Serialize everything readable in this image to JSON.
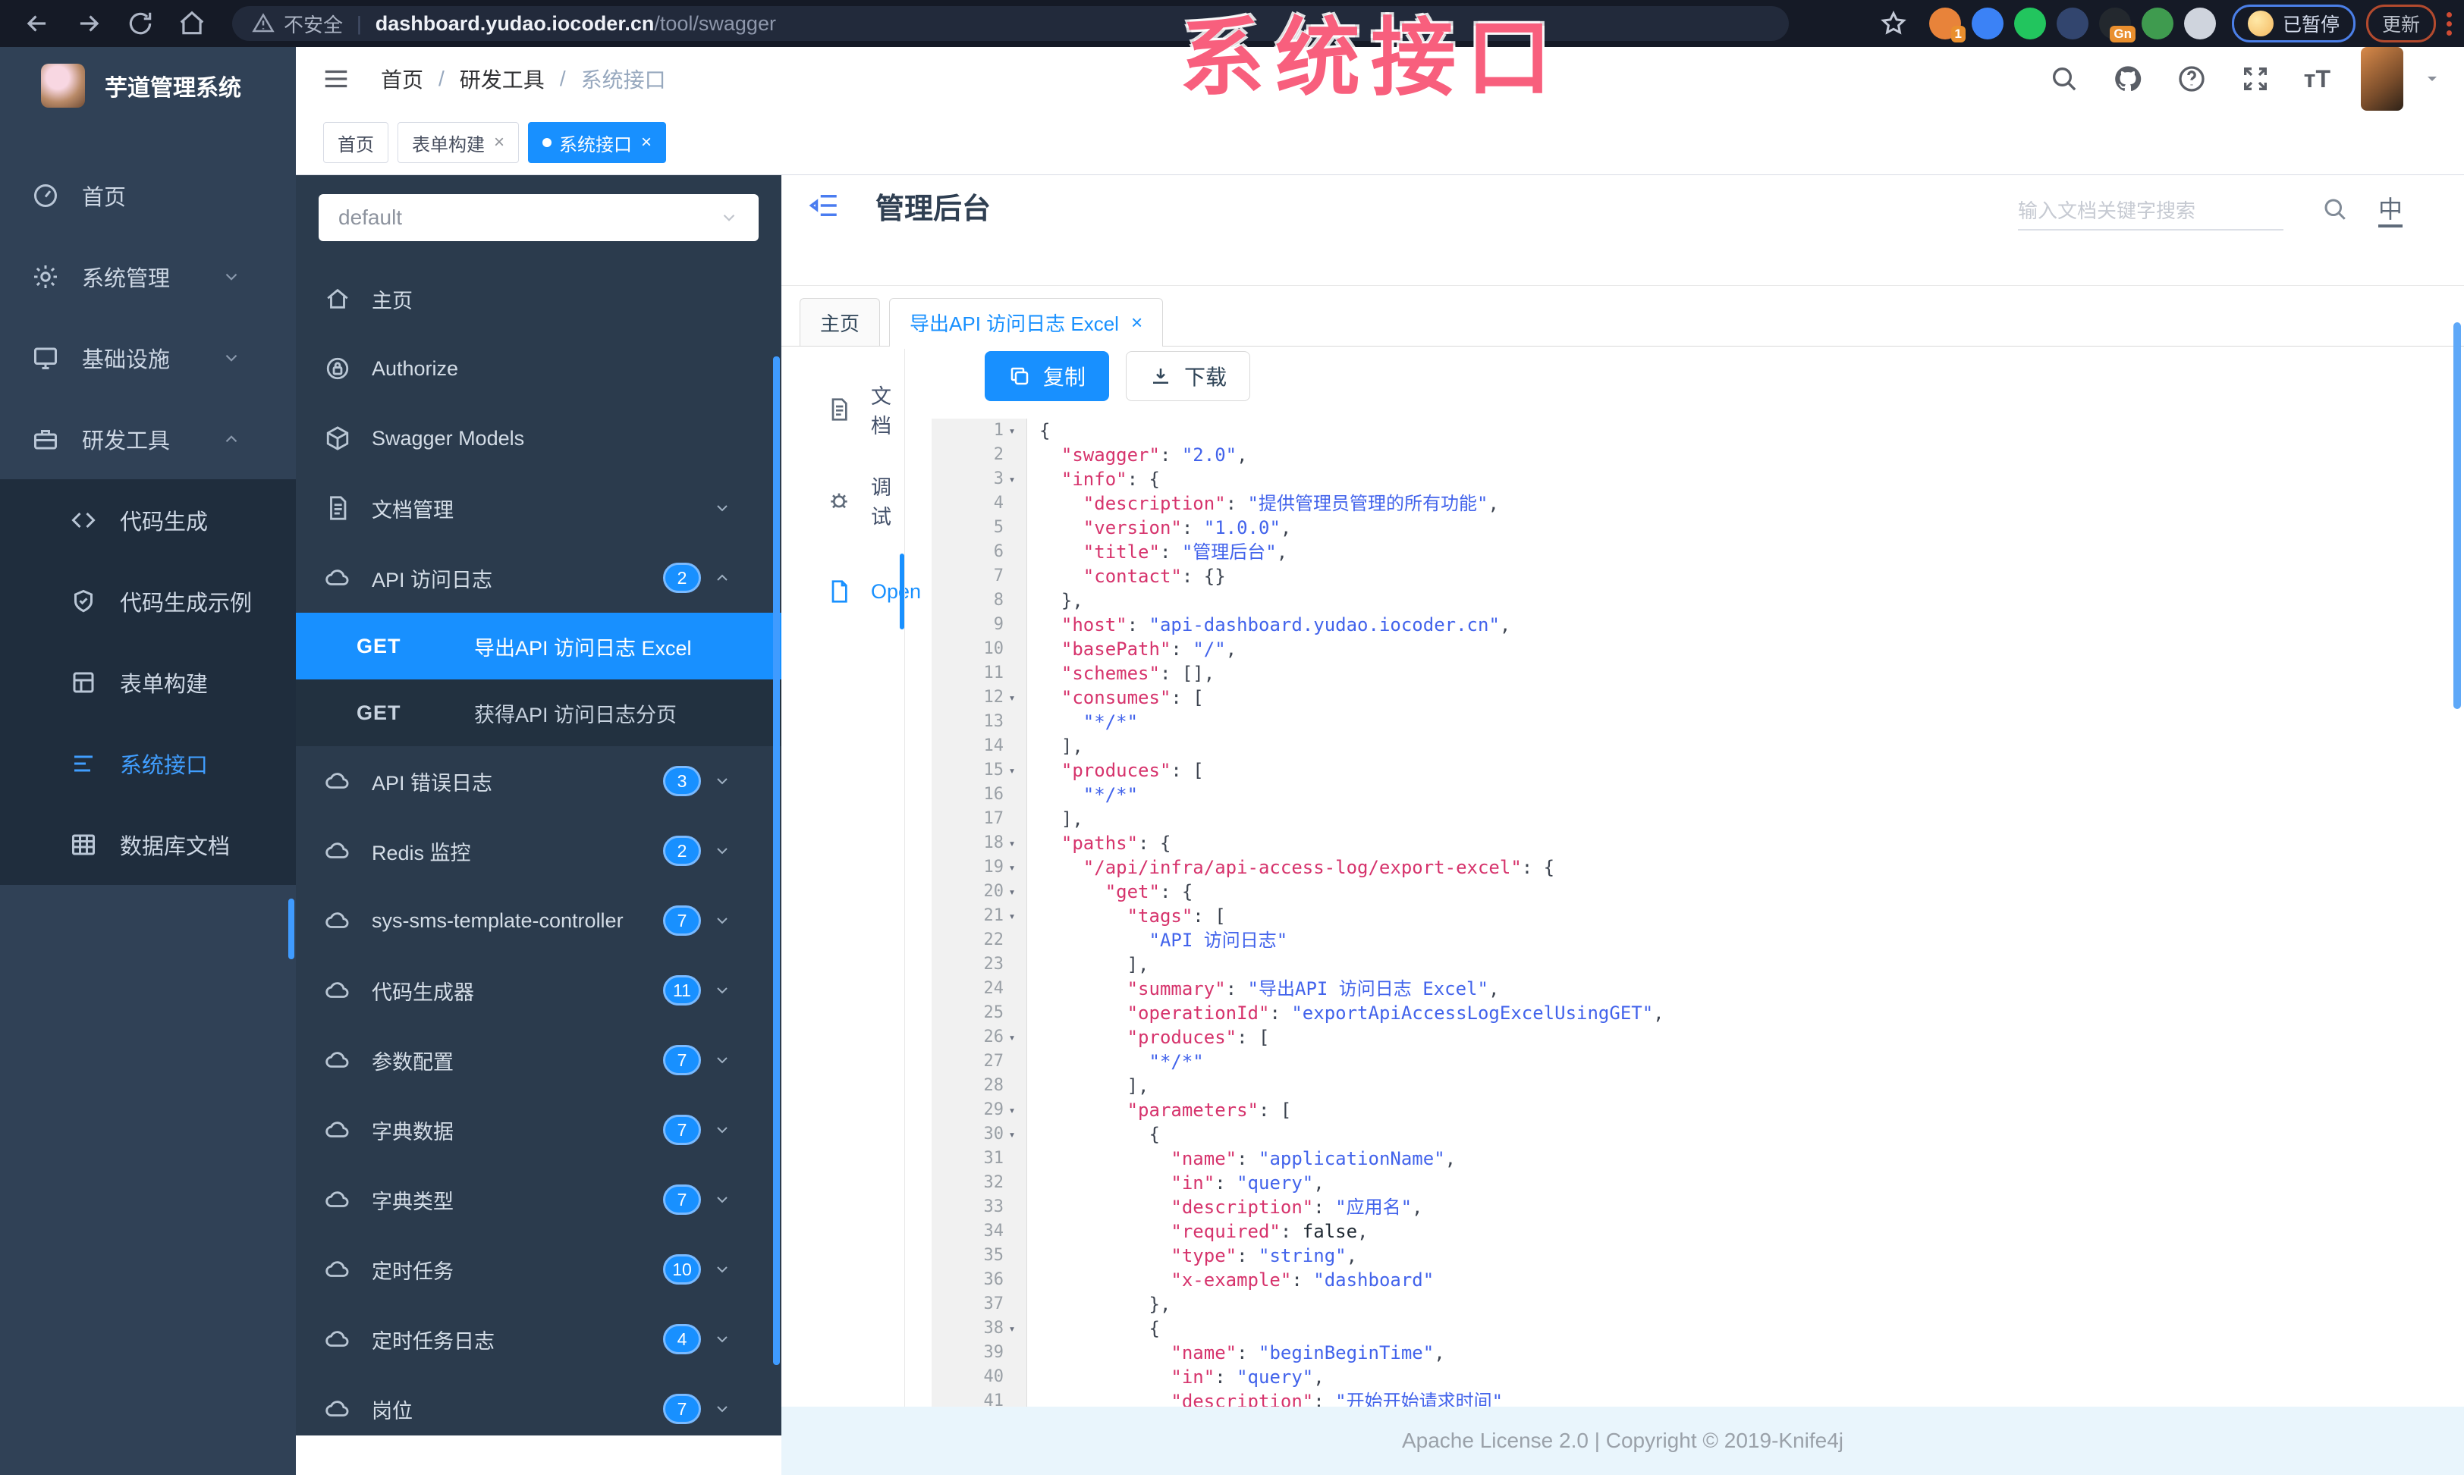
{
  "watermark": "系统接口",
  "browser": {
    "security_label": "不安全",
    "url_host": "dashboard.yudao.iocoder.cn",
    "url_path": "/tool/swagger",
    "paused_label": "已暂停",
    "update_label": "更新",
    "extensions": [
      {
        "name": "extension-lock",
        "color": "#e8833a",
        "badge": "1"
      },
      {
        "name": "extension-drop",
        "color": "#3b82f6",
        "badge": ""
      },
      {
        "name": "extension-green-circle",
        "color": "#22c55e",
        "badge": ""
      },
      {
        "name": "extension-pixels",
        "color": "#32456e",
        "badge": ""
      },
      {
        "name": "extension-dark",
        "color": "#23282e",
        "badge": "Gn"
      },
      {
        "name": "extension-leaf",
        "color": "#3f9b4f",
        "badge": ""
      },
      {
        "name": "extension-star",
        "color": "#cfd4dd",
        "badge": ""
      }
    ]
  },
  "app_sidebar": {
    "logo_title": "芋道管理系统",
    "items": [
      {
        "label": "首页",
        "icon": "gauge",
        "chevron": ""
      },
      {
        "label": "系统管理",
        "icon": "gear",
        "chevron": "down"
      },
      {
        "label": "基础设施",
        "icon": "monitor",
        "chevron": "down"
      },
      {
        "label": "研发工具",
        "icon": "briefcase",
        "chevron": "up"
      }
    ],
    "sub_items": [
      {
        "label": "代码生成",
        "icon": "code",
        "active": false
      },
      {
        "label": "代码生成示例",
        "icon": "shield",
        "active": false
      },
      {
        "label": "表单构建",
        "icon": "form",
        "active": false
      },
      {
        "label": "系统接口",
        "icon": "listicon",
        "active": true
      },
      {
        "label": "数据库文档",
        "icon": "tableicon",
        "active": false
      }
    ]
  },
  "topbar": {
    "breadcrumb": [
      "首页",
      "研发工具",
      "系统接口"
    ]
  },
  "tags": [
    {
      "label": "首页",
      "closable": false,
      "active": false
    },
    {
      "label": "表单构建",
      "closable": true,
      "active": false
    },
    {
      "label": "系统接口",
      "closable": true,
      "active": true
    }
  ],
  "doc_header": {
    "title": "管理后台",
    "search_placeholder": "输入文档关键字搜索",
    "lang_label": "中"
  },
  "doc_tabs": [
    {
      "label": "主页",
      "closable": false,
      "active": false
    },
    {
      "label": "导出API 访问日志 Excel",
      "closable": true,
      "active": true
    }
  ],
  "api_menu": {
    "select_value": "default",
    "items": [
      {
        "label": "主页",
        "icon": "home",
        "badge": "",
        "chevron": ""
      },
      {
        "label": "Authorize",
        "icon": "lock",
        "badge": "",
        "chevron": ""
      },
      {
        "label": "Swagger Models",
        "icon": "cube",
        "badge": "",
        "chevron": ""
      },
      {
        "label": "文档管理",
        "icon": "docicon",
        "badge": "",
        "chevron": "down"
      },
      {
        "label": "API 访问日志",
        "icon": "cloud",
        "badge": "2",
        "chevron": "up"
      }
    ],
    "operations": [
      {
        "method": "GET",
        "label": "导出API 访问日志 Excel",
        "active": true
      },
      {
        "method": "GET",
        "label": "获得API 访问日志分页",
        "active": false
      }
    ],
    "groups": [
      {
        "label": "API 错误日志",
        "badge": "3"
      },
      {
        "label": "Redis 监控",
        "badge": "2"
      },
      {
        "label": "sys-sms-template-controller",
        "badge": "7"
      },
      {
        "label": "代码生成器",
        "badge": "11"
      },
      {
        "label": "参数配置",
        "badge": "7"
      },
      {
        "label": "字典数据",
        "badge": "7"
      },
      {
        "label": "字典类型",
        "badge": "7"
      },
      {
        "label": "定时任务",
        "badge": "10"
      },
      {
        "label": "定时任务日志",
        "badge": "4"
      },
      {
        "label": "岗位",
        "badge": "7"
      }
    ]
  },
  "doc_panel": {
    "menu": [
      {
        "label": "文档",
        "icon": "docicon",
        "active": false
      },
      {
        "label": "调试",
        "icon": "debug",
        "active": false
      },
      {
        "label": "Open",
        "icon": "file",
        "active": true
      }
    ],
    "copy_label": "复制",
    "download_label": "下载"
  },
  "code": {
    "lines": [
      {
        "n": 1,
        "fold": true,
        "t": [
          [
            "p",
            "{"
          ]
        ]
      },
      {
        "n": 2,
        "fold": false,
        "t": [
          [
            "p",
            "  "
          ],
          [
            "k",
            "\"swagger\""
          ],
          [
            "p",
            ": "
          ],
          [
            "s",
            "\"2.0\""
          ],
          [
            "p",
            ","
          ]
        ]
      },
      {
        "n": 3,
        "fold": true,
        "t": [
          [
            "p",
            "  "
          ],
          [
            "k",
            "\"info\""
          ],
          [
            "p",
            ": {"
          ]
        ]
      },
      {
        "n": 4,
        "fold": false,
        "t": [
          [
            "p",
            "    "
          ],
          [
            "k",
            "\"description\""
          ],
          [
            "p",
            ": "
          ],
          [
            "s",
            "\"提供管理员管理的所有功能\""
          ],
          [
            "p",
            ","
          ]
        ]
      },
      {
        "n": 5,
        "fold": false,
        "t": [
          [
            "p",
            "    "
          ],
          [
            "k",
            "\"version\""
          ],
          [
            "p",
            ": "
          ],
          [
            "s",
            "\"1.0.0\""
          ],
          [
            "p",
            ","
          ]
        ]
      },
      {
        "n": 6,
        "fold": false,
        "t": [
          [
            "p",
            "    "
          ],
          [
            "k",
            "\"title\""
          ],
          [
            "p",
            ": "
          ],
          [
            "s",
            "\"管理后台\""
          ],
          [
            "p",
            ","
          ]
        ]
      },
      {
        "n": 7,
        "fold": false,
        "t": [
          [
            "p",
            "    "
          ],
          [
            "k",
            "\"contact\""
          ],
          [
            "p",
            ": {}"
          ]
        ]
      },
      {
        "n": 8,
        "fold": false,
        "t": [
          [
            "p",
            "  },"
          ]
        ]
      },
      {
        "n": 9,
        "fold": false,
        "t": [
          [
            "p",
            "  "
          ],
          [
            "k",
            "\"host\""
          ],
          [
            "p",
            ": "
          ],
          [
            "s",
            "\"api-dashboard.yudao.iocoder.cn\""
          ],
          [
            "p",
            ","
          ]
        ]
      },
      {
        "n": 10,
        "fold": false,
        "t": [
          [
            "p",
            "  "
          ],
          [
            "k",
            "\"basePath\""
          ],
          [
            "p",
            ": "
          ],
          [
            "s",
            "\"/\""
          ],
          [
            "p",
            ","
          ]
        ]
      },
      {
        "n": 11,
        "fold": false,
        "t": [
          [
            "p",
            "  "
          ],
          [
            "k",
            "\"schemes\""
          ],
          [
            "p",
            ": [],"
          ]
        ]
      },
      {
        "n": 12,
        "fold": true,
        "t": [
          [
            "p",
            "  "
          ],
          [
            "k",
            "\"consumes\""
          ],
          [
            "p",
            ": ["
          ]
        ]
      },
      {
        "n": 13,
        "fold": false,
        "t": [
          [
            "p",
            "    "
          ],
          [
            "s",
            "\"*/*\""
          ]
        ]
      },
      {
        "n": 14,
        "fold": false,
        "t": [
          [
            "p",
            "  ],"
          ]
        ]
      },
      {
        "n": 15,
        "fold": true,
        "t": [
          [
            "p",
            "  "
          ],
          [
            "k",
            "\"produces\""
          ],
          [
            "p",
            ": ["
          ]
        ]
      },
      {
        "n": 16,
        "fold": false,
        "t": [
          [
            "p",
            "    "
          ],
          [
            "s",
            "\"*/*\""
          ]
        ]
      },
      {
        "n": 17,
        "fold": false,
        "t": [
          [
            "p",
            "  ],"
          ]
        ]
      },
      {
        "n": 18,
        "fold": true,
        "t": [
          [
            "p",
            "  "
          ],
          [
            "k",
            "\"paths\""
          ],
          [
            "p",
            ": {"
          ]
        ]
      },
      {
        "n": 19,
        "fold": true,
        "t": [
          [
            "p",
            "    "
          ],
          [
            "k",
            "\"/api/infra/api-access-log/export-excel\""
          ],
          [
            "p",
            ": {"
          ]
        ]
      },
      {
        "n": 20,
        "fold": true,
        "t": [
          [
            "p",
            "      "
          ],
          [
            "k",
            "\"get\""
          ],
          [
            "p",
            ": {"
          ]
        ]
      },
      {
        "n": 21,
        "fold": true,
        "t": [
          [
            "p",
            "        "
          ],
          [
            "k",
            "\"tags\""
          ],
          [
            "p",
            ": ["
          ]
        ]
      },
      {
        "n": 22,
        "fold": false,
        "t": [
          [
            "p",
            "          "
          ],
          [
            "s",
            "\"API 访问日志\""
          ]
        ]
      },
      {
        "n": 23,
        "fold": false,
        "t": [
          [
            "p",
            "        ],"
          ]
        ]
      },
      {
        "n": 24,
        "fold": false,
        "t": [
          [
            "p",
            "        "
          ],
          [
            "k",
            "\"summary\""
          ],
          [
            "p",
            ": "
          ],
          [
            "s",
            "\"导出API 访问日志 Excel\""
          ],
          [
            "p",
            ","
          ]
        ]
      },
      {
        "n": 25,
        "fold": false,
        "t": [
          [
            "p",
            "        "
          ],
          [
            "k",
            "\"operationId\""
          ],
          [
            "p",
            ": "
          ],
          [
            "s",
            "\"exportApiAccessLogExcelUsingGET\""
          ],
          [
            "p",
            ","
          ]
        ]
      },
      {
        "n": 26,
        "fold": true,
        "t": [
          [
            "p",
            "        "
          ],
          [
            "k",
            "\"produces\""
          ],
          [
            "p",
            ": ["
          ]
        ]
      },
      {
        "n": 27,
        "fold": false,
        "t": [
          [
            "p",
            "          "
          ],
          [
            "s",
            "\"*/*\""
          ]
        ]
      },
      {
        "n": 28,
        "fold": false,
        "t": [
          [
            "p",
            "        ],"
          ]
        ]
      },
      {
        "n": 29,
        "fold": true,
        "t": [
          [
            "p",
            "        "
          ],
          [
            "k",
            "\"parameters\""
          ],
          [
            "p",
            ": ["
          ]
        ]
      },
      {
        "n": 30,
        "fold": true,
        "t": [
          [
            "p",
            "          {"
          ]
        ]
      },
      {
        "n": 31,
        "fold": false,
        "t": [
          [
            "p",
            "            "
          ],
          [
            "k",
            "\"name\""
          ],
          [
            "p",
            ": "
          ],
          [
            "s",
            "\"applicationName\""
          ],
          [
            "p",
            ","
          ]
        ]
      },
      {
        "n": 32,
        "fold": false,
        "t": [
          [
            "p",
            "            "
          ],
          [
            "k",
            "\"in\""
          ],
          [
            "p",
            ": "
          ],
          [
            "s",
            "\"query\""
          ],
          [
            "p",
            ","
          ]
        ]
      },
      {
        "n": 33,
        "fold": false,
        "t": [
          [
            "p",
            "            "
          ],
          [
            "k",
            "\"description\""
          ],
          [
            "p",
            ": "
          ],
          [
            "s",
            "\"应用名\""
          ],
          [
            "p",
            ","
          ]
        ]
      },
      {
        "n": 34,
        "fold": false,
        "t": [
          [
            "p",
            "            "
          ],
          [
            "k",
            "\"required\""
          ],
          [
            "p",
            ": "
          ],
          [
            "b",
            "false"
          ],
          [
            "p",
            ","
          ]
        ]
      },
      {
        "n": 35,
        "fold": false,
        "t": [
          [
            "p",
            "            "
          ],
          [
            "k",
            "\"type\""
          ],
          [
            "p",
            ": "
          ],
          [
            "s",
            "\"string\""
          ],
          [
            "p",
            ","
          ]
        ]
      },
      {
        "n": 36,
        "fold": false,
        "t": [
          [
            "p",
            "            "
          ],
          [
            "k",
            "\"x-example\""
          ],
          [
            "p",
            ": "
          ],
          [
            "s",
            "\"dashboard\""
          ]
        ]
      },
      {
        "n": 37,
        "fold": false,
        "t": [
          [
            "p",
            "          },"
          ]
        ]
      },
      {
        "n": 38,
        "fold": true,
        "t": [
          [
            "p",
            "          {"
          ]
        ]
      },
      {
        "n": 39,
        "fold": false,
        "t": [
          [
            "p",
            "            "
          ],
          [
            "k",
            "\"name\""
          ],
          [
            "p",
            ": "
          ],
          [
            "s",
            "\"beginBeginTime\""
          ],
          [
            "p",
            ","
          ]
        ]
      },
      {
        "n": 40,
        "fold": false,
        "t": [
          [
            "p",
            "            "
          ],
          [
            "k",
            "\"in\""
          ],
          [
            "p",
            ": "
          ],
          [
            "s",
            "\"query\""
          ],
          [
            "p",
            ","
          ]
        ]
      },
      {
        "n": 41,
        "fold": false,
        "t": [
          [
            "p",
            "            "
          ],
          [
            "k",
            "\"description\""
          ],
          [
            "p",
            ": "
          ],
          [
            "s",
            "\"开始开始请求时间\""
          ]
        ]
      }
    ]
  },
  "footer": "Apache License 2.0 | Copyright © 2019-Knife4j",
  "colors": {
    "accent": "#1890ff",
    "sidebar_bg": "#304156",
    "submenu_bg": "#1f2d3d",
    "api_sidebar_bg": "#2b3b4d",
    "watermark": "#f85f7d",
    "footer_bg": "#e9f5fc"
  }
}
